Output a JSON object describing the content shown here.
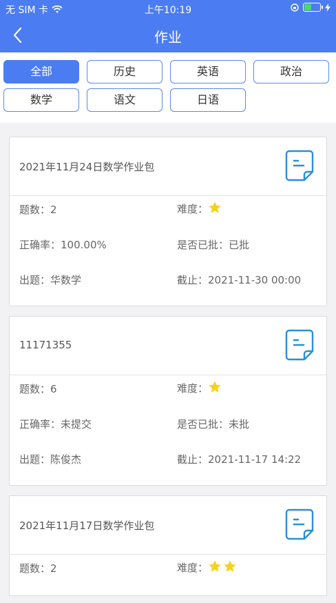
{
  "status_bar": {
    "carrier": "无 SIM 卡",
    "time": "上午10:19"
  },
  "header": {
    "title": "作业"
  },
  "filters": [
    "全部",
    "历史",
    "英语",
    "政治",
    "数学",
    "语文",
    "日语"
  ],
  "active_filter": "全部",
  "labels": {
    "count": "题数：",
    "difficulty": "难度：",
    "accuracy": "正确率：",
    "graded": "是否已批：",
    "author": "出题：",
    "deadline": "截止："
  },
  "assignments": [
    {
      "title": "2021年11月24日数学作业包",
      "count": "2",
      "difficulty_stars": 1,
      "accuracy": "100.00%",
      "graded": "已批",
      "author": "华数学",
      "deadline": "2021-11-30 00:00"
    },
    {
      "title": "11171355",
      "count": "6",
      "difficulty_stars": 1,
      "accuracy": "未提交",
      "graded": "未批",
      "author": "陈俊杰",
      "deadline": "2021-11-17 14:22"
    },
    {
      "title": "2021年11月17日数学作业包",
      "count": "2",
      "difficulty_stars": 2
    }
  ],
  "colors": {
    "primary": "#4b7cf2",
    "star": "#f7d21b",
    "icon": "#2a8fd6"
  }
}
